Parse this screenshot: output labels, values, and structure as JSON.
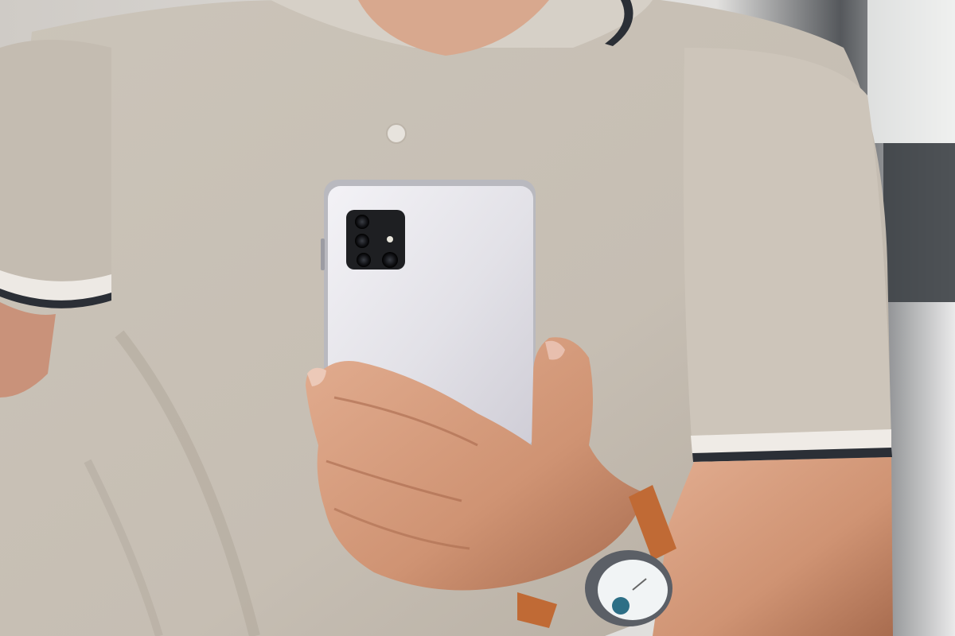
{
  "scene": {
    "colors": {
      "background_light": "#e6e6e4",
      "background_dark": "#3a3e42",
      "chair_blue": "#2e8fb0",
      "shirt": "#c9c1b6",
      "shirt_shadow": "#a89f93",
      "collar_stripe": "#2b2f36",
      "skin": "#d49b7c",
      "skin_shadow": "#b07658",
      "phone_body": "#e4e3e8",
      "phone_frame": "#b9b9bf",
      "camera_module": "#1e1f22",
      "watch_strap": "#c06a35",
      "watch_case": "#5b5f66",
      "watch_face": "#f1f4f5",
      "watch_dial_accent": "#2d6f86"
    },
    "icons": [
      "camera-lens-icon",
      "flash-icon"
    ]
  }
}
